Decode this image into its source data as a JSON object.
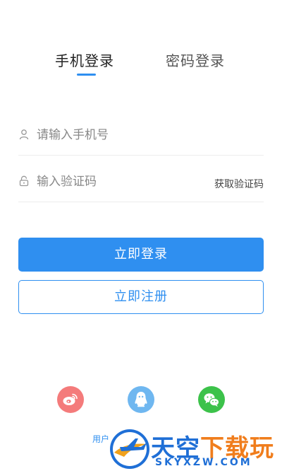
{
  "tabs": {
    "phone_login": "手机登录",
    "password_login": "密码登录"
  },
  "form": {
    "phone_placeholder": "请输入手机号",
    "code_placeholder": "输入验证码",
    "get_code_label": "获取验证码"
  },
  "buttons": {
    "login": "立即登录",
    "register": "立即注册"
  },
  "social": {
    "icons": [
      "weibo-icon",
      "qq-icon",
      "wechat-icon"
    ]
  },
  "footer": {
    "agreement_partial": "用户"
  },
  "watermark": {
    "text_part1": "天空",
    "text_part2": "下载玩",
    "domain": "SKYXZW.COM"
  },
  "colors": {
    "accent": "#2f8ff0",
    "weibo": "#f47b7b",
    "qq": "#6fb7f0",
    "wechat": "#3cc24a"
  }
}
